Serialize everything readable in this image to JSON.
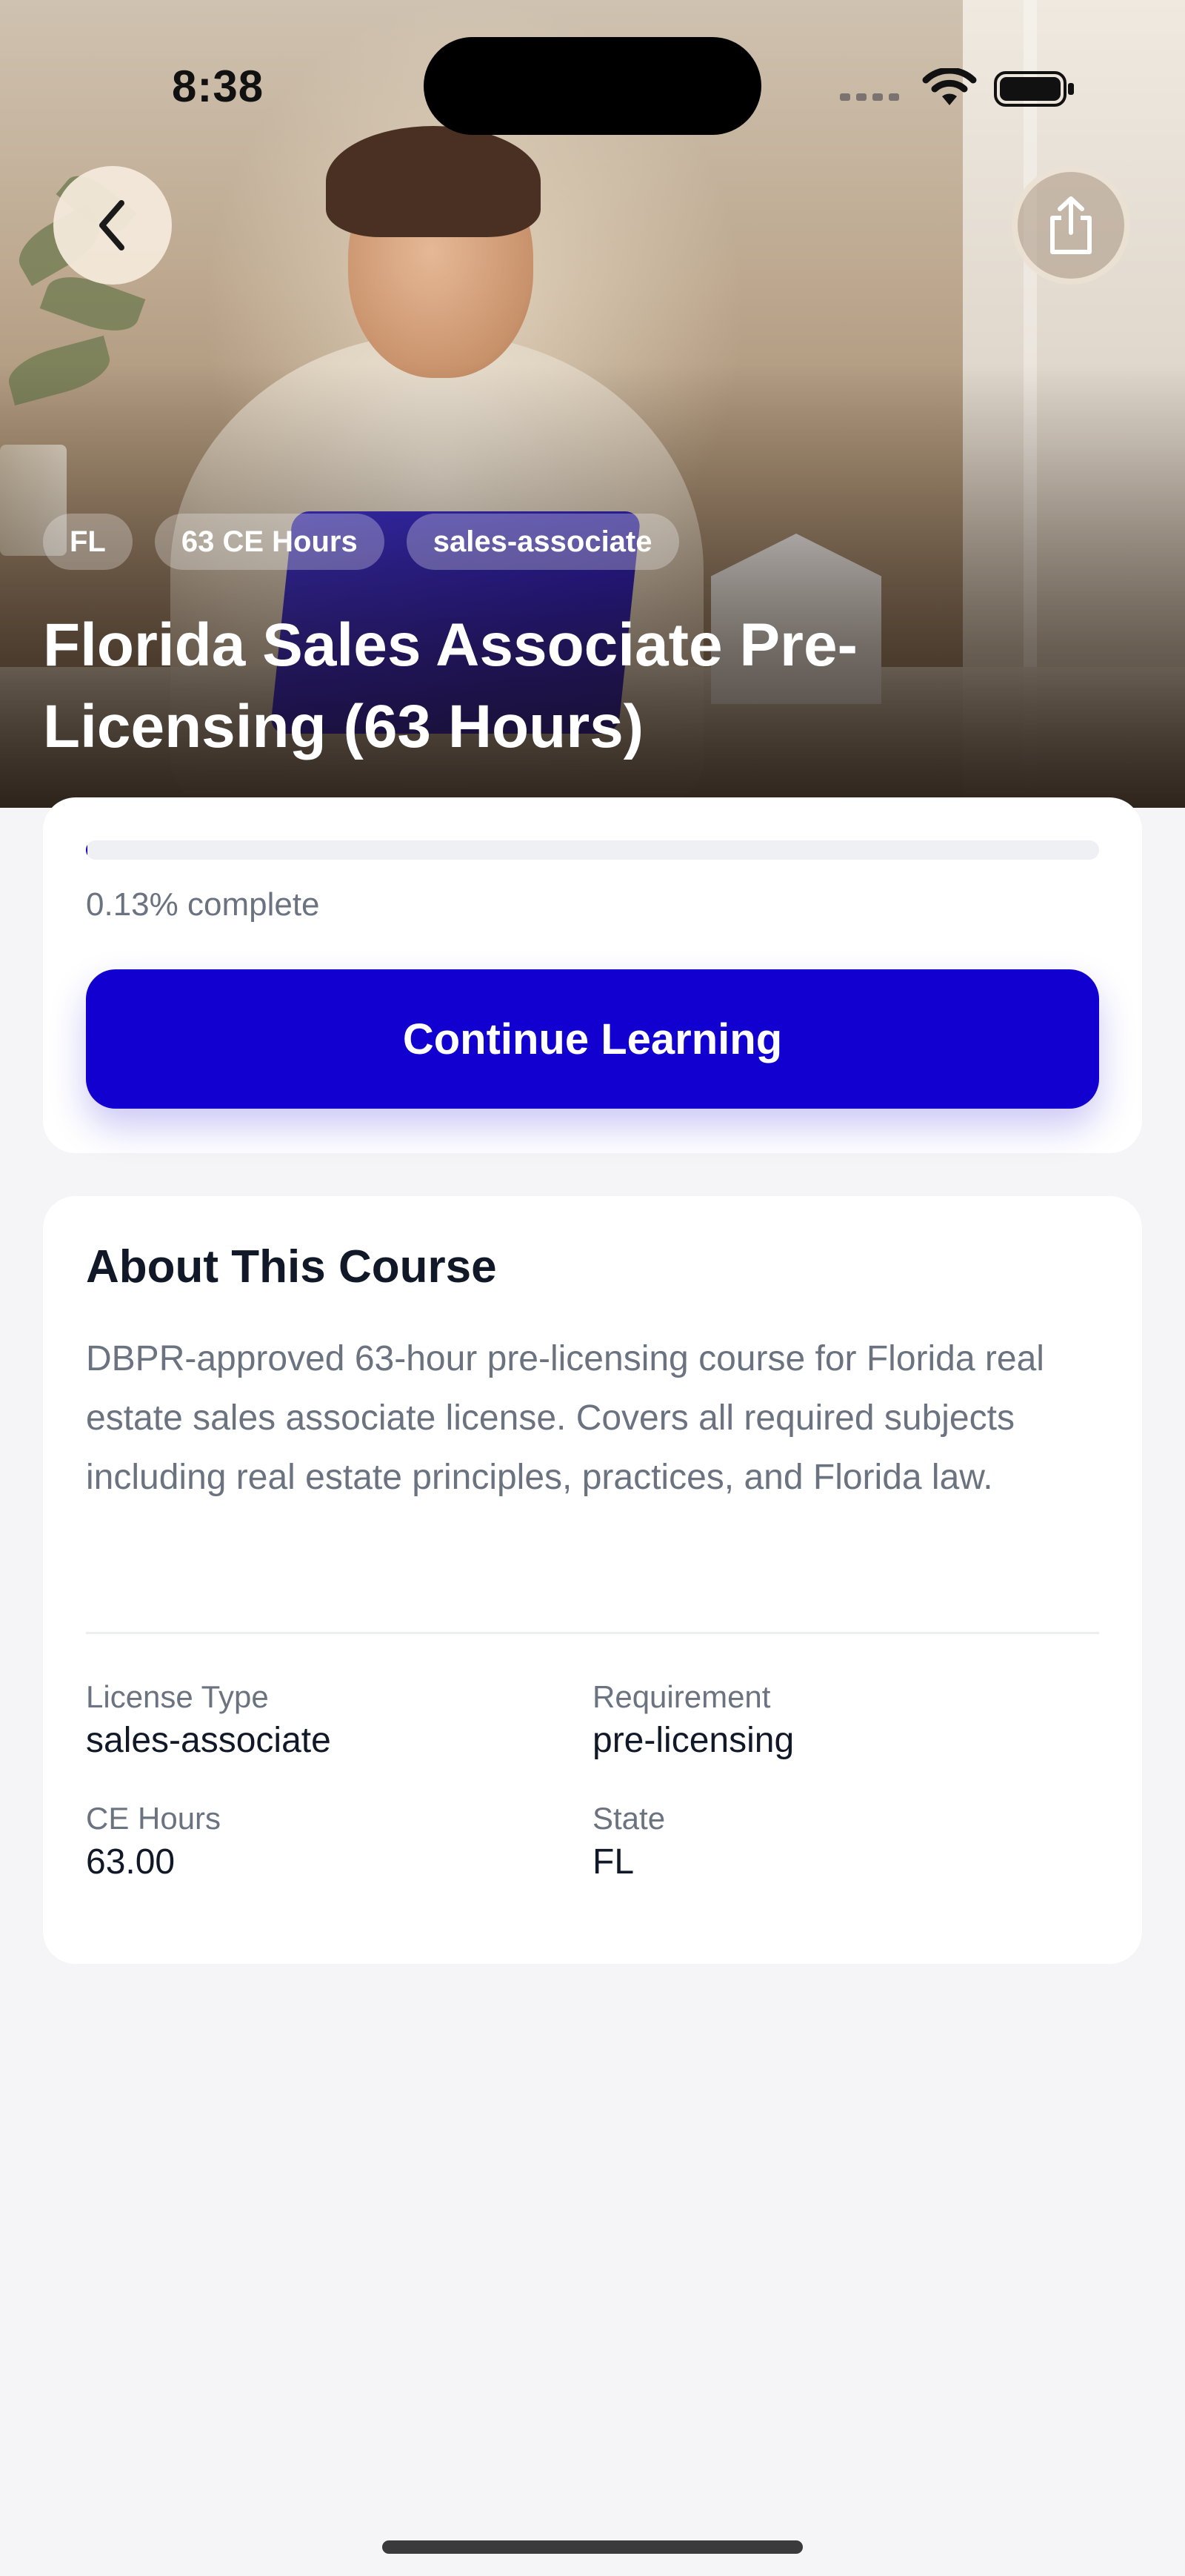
{
  "status_bar": {
    "time": "8:38"
  },
  "hero": {
    "tags": [
      "FL",
      "63 CE Hours",
      "sales-associate"
    ],
    "title": "Florida Sales Associate Pre-Licensing (63 Hours)"
  },
  "progress": {
    "percent": 0.13,
    "text": "0.13% complete",
    "button_label": "Continue Learning"
  },
  "about": {
    "title": "About This Course",
    "description": "DBPR-approved 63-hour pre-licensing course for Florida real estate sales associate license. Covers all required subjects including real estate principles, practices, and Florida law.",
    "details": [
      {
        "label": "License Type",
        "value": "sales-associate"
      },
      {
        "label": "Requirement",
        "value": "pre-licensing"
      },
      {
        "label": "CE Hours",
        "value": "63.00"
      },
      {
        "label": "State",
        "value": "FL"
      }
    ]
  },
  "icons": {
    "back": "chevron-left-icon",
    "share": "share-icon",
    "wifi": "wifi-icon",
    "battery": "battery-icon"
  },
  "colors": {
    "accent": "#1100d0",
    "background": "#f5f5f7",
    "muted_text": "#6b7280"
  }
}
